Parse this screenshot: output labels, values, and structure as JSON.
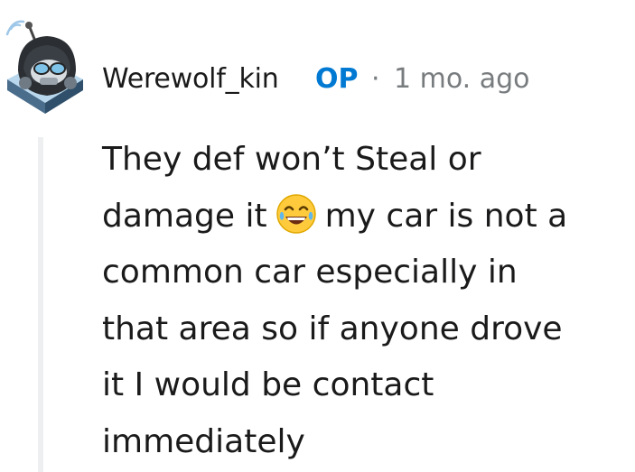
{
  "comment": {
    "author": "Werewolf_kin",
    "badge": "OP",
    "separator": "·",
    "timestamp": "1 mo. ago",
    "avatar_icon": "snoo-avatar-icon",
    "body": {
      "line1": "They def won’t Steal or",
      "line2_before_emoji": "damage it",
      "emoji_icon": "face-with-tears-of-joy-icon",
      "line2_after_emoji": "my car is not a",
      "line3": "common car especially in",
      "line4": "that area so if anyone drove",
      "line5": "it I would be contact",
      "line6": "immediately"
    }
  },
  "colors": {
    "op_badge": "#0079d3",
    "meta_text": "#787c7e",
    "thread_line": "#edeff1",
    "body_text": "#1a1a1b"
  }
}
